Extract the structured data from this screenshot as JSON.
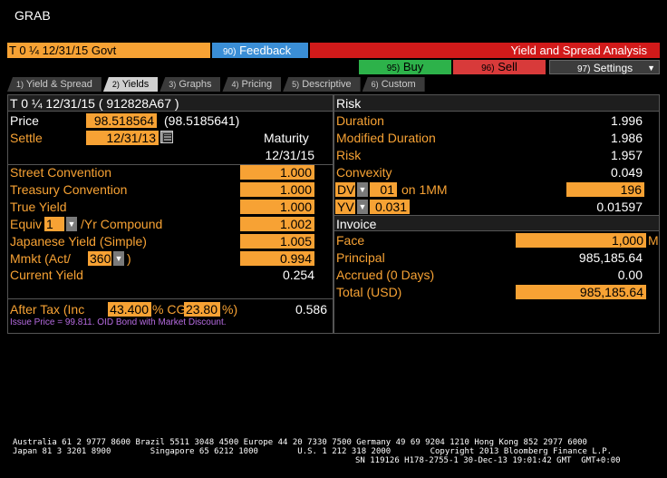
{
  "window": {
    "title": "GRAB"
  },
  "security": {
    "ticker_box": "T 0 ¼ 12/31/15 Govt"
  },
  "buttons": {
    "feedback": {
      "key": "90)",
      "label": "Feedback"
    },
    "analysis_title": "Yield and Spread Analysis",
    "buy": {
      "key": "95)",
      "label": "Buy"
    },
    "sell": {
      "key": "96)",
      "label": "Sell"
    },
    "settings": {
      "key": "97)",
      "label": "Settings"
    }
  },
  "tabs": [
    {
      "key": "1)",
      "label": "Yield & Spread",
      "active": false
    },
    {
      "key": "2)",
      "label": "Yields",
      "active": true
    },
    {
      "key": "3)",
      "label": "Graphs",
      "active": false
    },
    {
      "key": "4)",
      "label": "Pricing",
      "active": false
    },
    {
      "key": "5)",
      "label": "Descriptive",
      "active": false
    },
    {
      "key": "6)",
      "label": "Custom",
      "active": false
    }
  ],
  "left": {
    "header": "T 0 ¼ 12/31/15 ( 912828A67 )",
    "price_label": "Price",
    "price_value": "98.518564",
    "price_full": "(98.5185641)",
    "settle_label": "Settle",
    "settle_value": "12/31/13",
    "maturity_label": "Maturity",
    "maturity_value": "12/31/15",
    "street_label": "Street Convention",
    "street_value": "1.000",
    "treasury_label": "Treasury Convention",
    "treasury_value": "1.000",
    "true_label": "True Yield",
    "true_value": "1.000",
    "equiv_label": "Equiv",
    "equiv_freq": "1",
    "equiv_suffix": "/Yr Compound",
    "equiv_value": "1.002",
    "japanese_label": "Japanese Yield (Simple)",
    "japanese_value": "1.005",
    "mmkt_label": "Mmkt (Act/",
    "mmkt_basis": "360",
    "mmkt_close": ")",
    "mmkt_value": "0.994",
    "current_label": "Current Yield",
    "current_value": "0.254",
    "aftertax_label": "After Tax  (Inc",
    "aftertax_inc": "43.400",
    "aftertax_cg_label": "% CG",
    "aftertax_cg": "23.80",
    "aftertax_pct": "%)",
    "aftertax_value": "0.586",
    "note": "Issue Price = 99.811.  OID Bond with Market Discount."
  },
  "risk": {
    "header": "Risk",
    "duration_label": "Duration",
    "duration_value": "1.996",
    "modified_label": "Modified Duration",
    "modified_value": "1.986",
    "risk_label": "Risk",
    "risk_value": "1.957",
    "convexity_label": "Convexity",
    "convexity_value": "0.049",
    "dv_label": "DV",
    "dv_amount": "01",
    "dv_on": "on 1MM",
    "dv_value": "196",
    "yv_label": "YV",
    "yv_input": "0.031",
    "yv_value": "0.01597"
  },
  "invoice": {
    "header": "Invoice",
    "face_label": "Face",
    "face_value": "1,000",
    "face_unit": "M",
    "principal_label": "Principal",
    "principal_value": "985,185.64",
    "accrued_label": "Accrued (0 Days)",
    "accrued_value": "0.00",
    "total_label": "Total  (USD)",
    "total_value": "985,185.64"
  },
  "footer": {
    "line1": "Australia 61 2 9777 8600 Brazil 5511 3048 4500 Europe 44 20 7330 7500 Germany 49 69 9204 1210 Hong Kong 852 2977 6000",
    "line2": "Japan 81 3 3201 8900        Singapore 65 6212 1000        U.S. 1 212 318 2000        Copyright 2013 Bloomberg Finance L.P.",
    "line3": "SN 119126 H178-2755-1 30-Dec-13 19:01:42 GMT  GMT+0:00"
  }
}
